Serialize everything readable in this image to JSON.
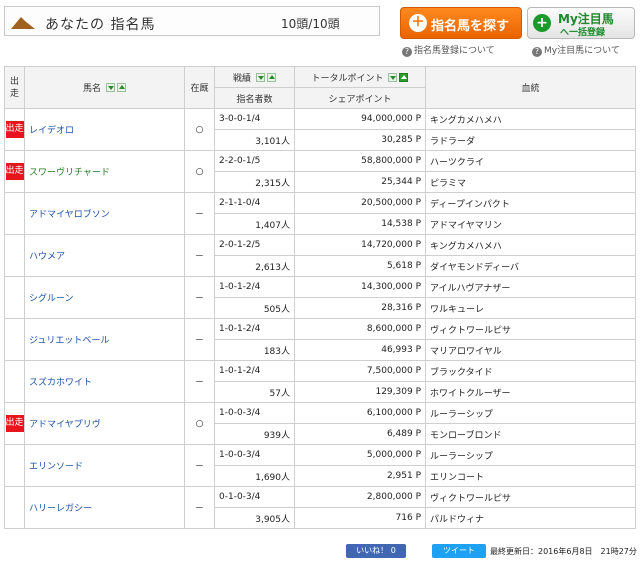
{
  "header": {
    "title": "あなたの 指名馬",
    "count": "10頭/10頭",
    "search_button": "指名馬を探す",
    "my_button_line1": "My注目馬",
    "my_button_line2": "へ一括登録",
    "help_left": "指名馬登録について",
    "help_right": "My注目馬について"
  },
  "table": {
    "col_deso": "出走",
    "col_name": "馬名",
    "col_zai": "在厩",
    "col_record": "戦績",
    "col_nominators": "指名者数",
    "col_total": "トータルポイント",
    "col_share": "シェアポイント",
    "col_blood": "血統",
    "rows": [
      {
        "deso": true,
        "name": "レイデオロ",
        "green": false,
        "zai": "○",
        "record": "3-0-0-1/4",
        "nominators": "3,101人",
        "total": "94,000,000 P",
        "share": "30,285 P",
        "sire": "キングカメハメハ",
        "dam": "ラドラーダ"
      },
      {
        "deso": true,
        "name": "スワーヴリチャード",
        "green": true,
        "zai": "○",
        "record": "2-2-0-1/5",
        "nominators": "2,315人",
        "total": "58,800,000 P",
        "share": "25,344 P",
        "sire": "ハーツクライ",
        "dam": "ピラミマ"
      },
      {
        "deso": false,
        "name": "アドマイヤロブソン",
        "green": false,
        "zai": "－",
        "record": "2-1-1-0/4",
        "nominators": "1,407人",
        "total": "20,500,000 P",
        "share": "14,538 P",
        "sire": "ディープインパクト",
        "dam": "アドマイヤマリン"
      },
      {
        "deso": false,
        "name": "ハウメア",
        "green": false,
        "zai": "－",
        "record": "2-0-1-2/5",
        "nominators": "2,613人",
        "total": "14,720,000 P",
        "share": "5,618 P",
        "sire": "キングカメハメハ",
        "dam": "ダイヤモンドディーバ"
      },
      {
        "deso": false,
        "name": "シグルーン",
        "green": false,
        "zai": "－",
        "record": "1-0-1-2/4",
        "nominators": "505人",
        "total": "14,300,000 P",
        "share": "28,316 P",
        "sire": "アイルハヴアナザー",
        "dam": "ワルキューレ"
      },
      {
        "deso": false,
        "name": "ジュリエットベール",
        "green": false,
        "zai": "－",
        "record": "1-0-1-2/4",
        "nominators": "183人",
        "total": "8,600,000 P",
        "share": "46,993 P",
        "sire": "ヴィクトワールピサ",
        "dam": "マリアロワイヤル"
      },
      {
        "deso": false,
        "name": "スズカホワイト",
        "green": false,
        "zai": "－",
        "record": "1-0-1-2/4",
        "nominators": "57人",
        "total": "7,500,000 P",
        "share": "129,309 P",
        "sire": "ブラックタイド",
        "dam": "ホワイトクルーザー"
      },
      {
        "deso": true,
        "name": "アドマイヤプリヴ",
        "green": false,
        "zai": "○",
        "record": "1-0-0-3/4",
        "nominators": "939人",
        "total": "6,100,000 P",
        "share": "6,489 P",
        "sire": "ルーラーシップ",
        "dam": "モンローブロンド"
      },
      {
        "deso": false,
        "name": "エリンソード",
        "green": false,
        "zai": "－",
        "record": "1-0-0-3/4",
        "nominators": "1,690人",
        "total": "5,000,000 P",
        "share": "2,951 P",
        "sire": "ルーラーシップ",
        "dam": "エリンコート"
      },
      {
        "deso": false,
        "name": "ハリーレガシー",
        "green": false,
        "zai": "－",
        "record": "0-1-0-3/4",
        "nominators": "3,905人",
        "total": "2,800,000 P",
        "share": "716 P",
        "sire": "ヴィクトワールピサ",
        "dam": "パルドウィナ"
      }
    ]
  },
  "footer": {
    "like": "いいね！ 0",
    "tweet": "ツイート",
    "updated": "最終更新日：2016年6月8日　21時27分"
  },
  "colors": {
    "accent_orange": "#ee6b00",
    "accent_green": "#1a9a2a",
    "badge_red": "#e8141e",
    "link_blue": "#1a4fa8"
  }
}
